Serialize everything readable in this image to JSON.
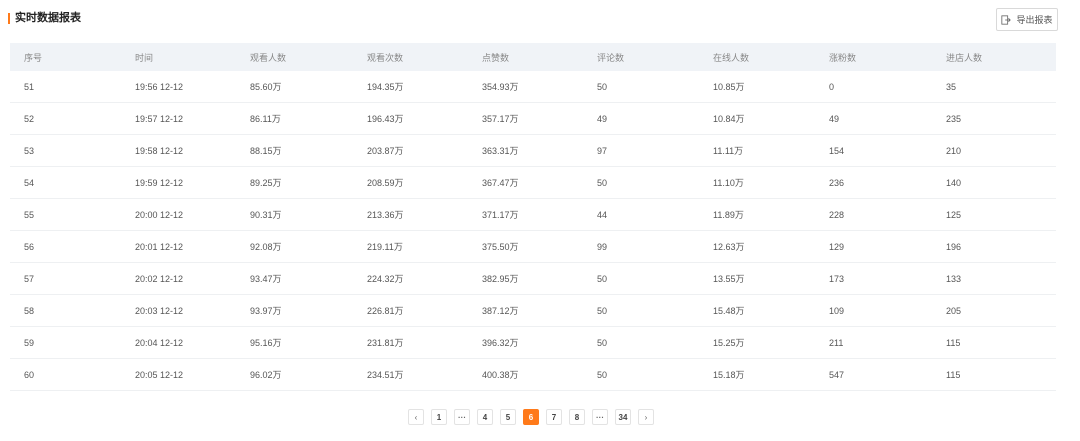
{
  "header": {
    "title": "实时数据报表",
    "export_label": "导出报表",
    "accent_color": "#ff7a1a",
    "export_icon": "export-icon"
  },
  "table": {
    "columns": [
      "序号",
      "时间",
      "观看人数",
      "观看次数",
      "点赞数",
      "评论数",
      "在线人数",
      "涨粉数",
      "进店人数"
    ],
    "rows": [
      [
        "51",
        "19:56 12-12",
        "85.60万",
        "194.35万",
        "354.93万",
        "50",
        "10.85万",
        "0",
        "35"
      ],
      [
        "52",
        "19:57 12-12",
        "86.11万",
        "196.43万",
        "357.17万",
        "49",
        "10.84万",
        "49",
        "235"
      ],
      [
        "53",
        "19:58 12-12",
        "88.15万",
        "203.87万",
        "363.31万",
        "97",
        "11.11万",
        "154",
        "210"
      ],
      [
        "54",
        "19:59 12-12",
        "89.25万",
        "208.59万",
        "367.47万",
        "50",
        "11.10万",
        "236",
        "140"
      ],
      [
        "55",
        "20:00 12-12",
        "90.31万",
        "213.36万",
        "371.17万",
        "44",
        "11.89万",
        "228",
        "125"
      ],
      [
        "56",
        "20:01 12-12",
        "92.08万",
        "219.11万",
        "375.50万",
        "99",
        "12.63万",
        "129",
        "196"
      ],
      [
        "57",
        "20:02 12-12",
        "93.47万",
        "224.32万",
        "382.95万",
        "50",
        "13.55万",
        "173",
        "133"
      ],
      [
        "58",
        "20:03 12-12",
        "93.97万",
        "226.81万",
        "387.12万",
        "50",
        "15.48万",
        "109",
        "205"
      ],
      [
        "59",
        "20:04 12-12",
        "95.16万",
        "231.81万",
        "396.32万",
        "50",
        "15.25万",
        "211",
        "115"
      ],
      [
        "60",
        "20:05 12-12",
        "96.02万",
        "234.51万",
        "400.38万",
        "50",
        "15.18万",
        "547",
        "115"
      ]
    ]
  },
  "pagination": {
    "prev": "‹",
    "next": "›",
    "items": [
      "1",
      "···",
      "4",
      "5",
      "6",
      "7",
      "8",
      "···",
      "34"
    ],
    "current": "6"
  }
}
